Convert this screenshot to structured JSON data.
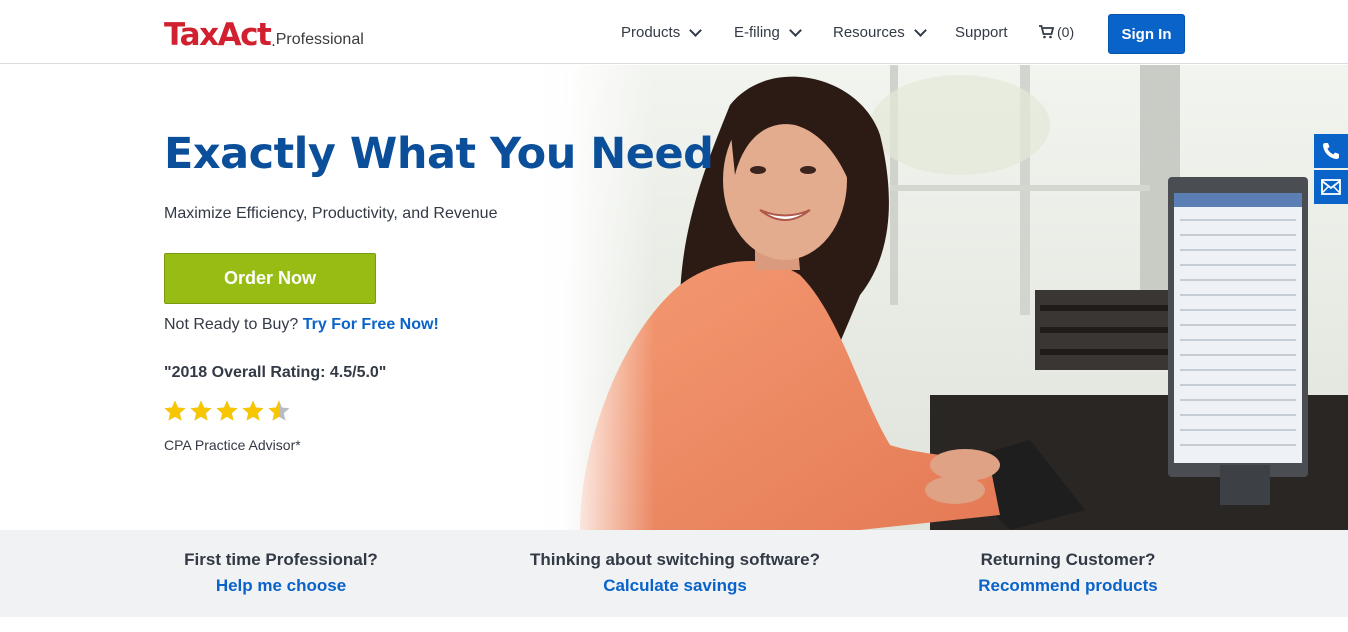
{
  "brand": {
    "name_part1": "Tax",
    "name_part2": "Act",
    "dot": ".",
    "sub": "Professional",
    "color": "#d1202f"
  },
  "nav": {
    "items": [
      {
        "label": "Products",
        "dropdown": true
      },
      {
        "label": "E-filing",
        "dropdown": true
      },
      {
        "label": "Resources",
        "dropdown": true
      },
      {
        "label": "Support",
        "dropdown": false
      }
    ],
    "cart_count": "(0)",
    "signin_label": "Sign In"
  },
  "hero": {
    "title": "Exactly What You Need",
    "subtitle": "Maximize Efficiency, Productivity, and Revenue",
    "order_label": "Order Now",
    "try_prefix": "Not Ready to Buy?",
    "try_link": "Try For Free Now!",
    "rating_text": "\"2018 Overall Rating: 4.5/5.0\"",
    "rating_value": 4.5,
    "rating_max": 5,
    "rating_source": "CPA Practice Advisor*"
  },
  "side_tabs": [
    {
      "icon": "phone-icon"
    },
    {
      "icon": "mail-icon"
    }
  ],
  "bottom": {
    "columns": [
      {
        "question": "First time Professional?",
        "link": "Help me choose"
      },
      {
        "question": "Thinking about switching software?",
        "link": "Calculate savings"
      },
      {
        "question": "Returning Customer?",
        "link": "Recommend products"
      }
    ]
  },
  "colors": {
    "primary_blue": "#0a63c9",
    "title_blue": "#0b4f9a",
    "order_green": "#97bd15",
    "star_yellow": "#f7c600"
  }
}
